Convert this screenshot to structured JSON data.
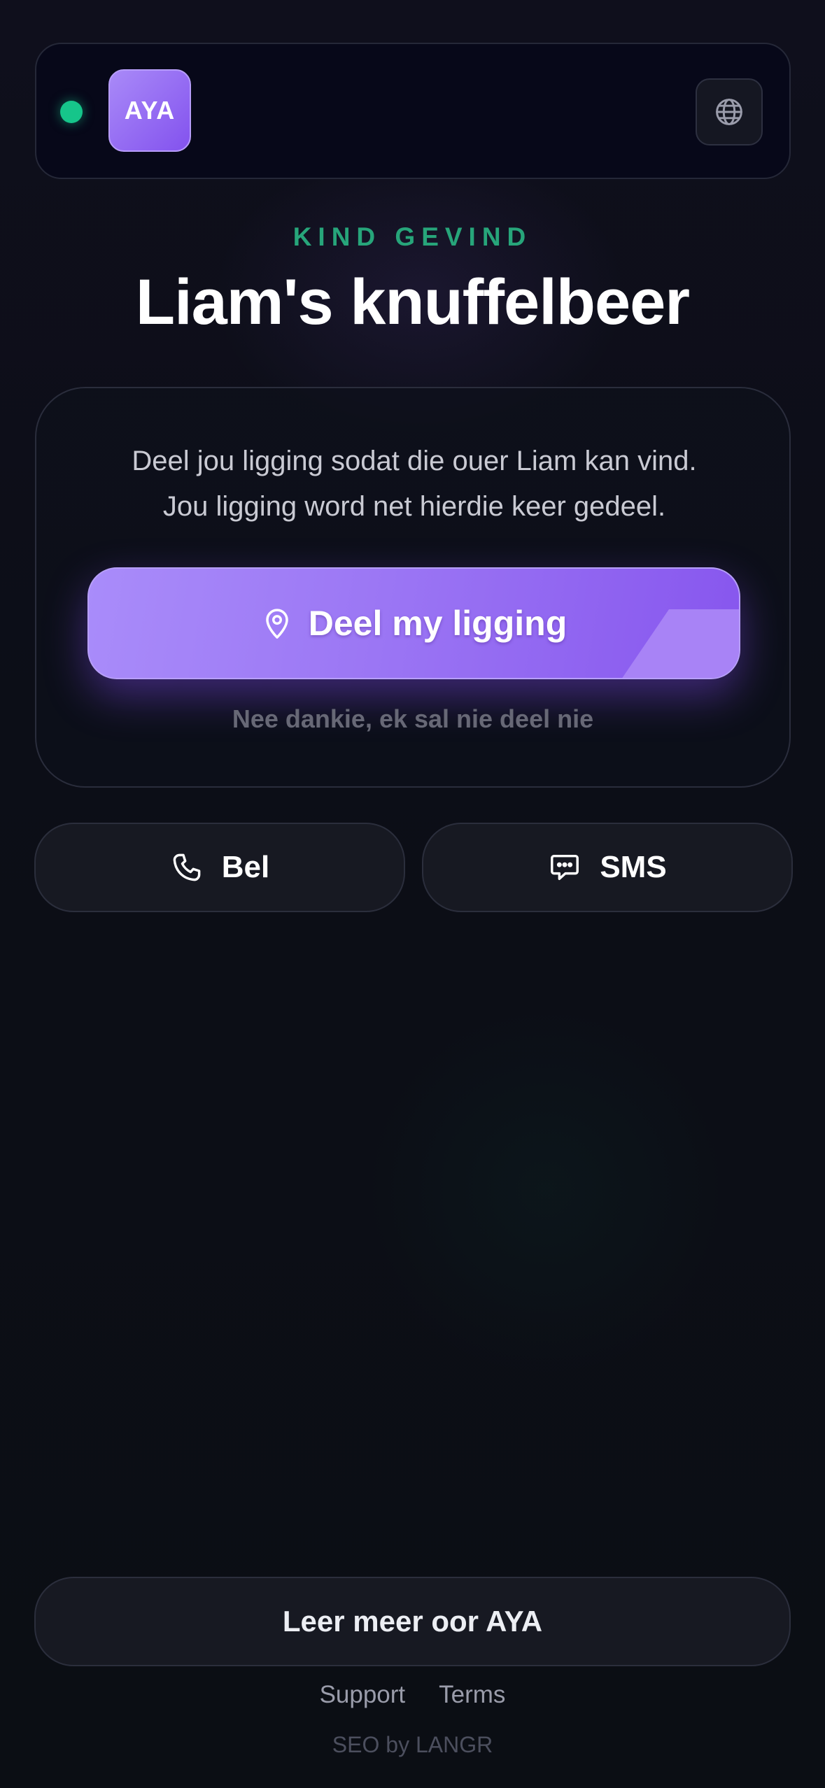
{
  "header": {
    "status": "online",
    "logo_text": "AYA",
    "language_icon": "globe-icon"
  },
  "hero": {
    "eyebrow": "KIND GEVIND",
    "title": "Liam's knuffelbeer"
  },
  "share_card": {
    "text_line1": "Deel jou ligging sodat die ouer Liam kan vind.",
    "text_line2": "Jou ligging word net hierdie keer gedeel.",
    "share_button": {
      "label": "Deel my ligging",
      "icon": "map-pin-icon"
    },
    "decline_label": "Nee dankie, ek sal nie deel nie"
  },
  "contact": {
    "call": {
      "label": "Bel",
      "icon": "phone-icon"
    },
    "sms": {
      "label": "SMS",
      "icon": "chat-bubble-icon"
    }
  },
  "footer": {
    "learn_more": "Leer meer oor AYA",
    "links": [
      "Support",
      "Terms"
    ],
    "credit": "SEO by LANGR"
  },
  "colors": {
    "accent_purple": "#8b5cf6",
    "status_green": "#16c58a",
    "eyebrow_green": "#27a57a",
    "background": "#0c0e17"
  }
}
